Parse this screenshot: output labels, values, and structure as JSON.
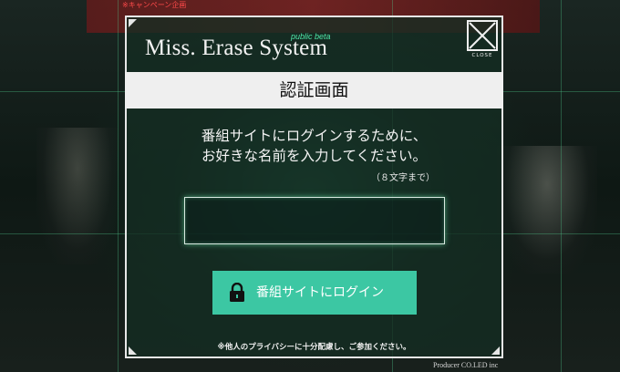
{
  "background": {
    "banner_note": "※キャンペーン企画"
  },
  "modal": {
    "logo": "Miss. Erase System",
    "beta_tag": "public beta",
    "close_label": "CLOSE",
    "title": "認証画面",
    "instruction_line1": "番組サイトにログインするために、",
    "instruction_line2": "お好きな名前を入力してください。",
    "limit_note": "（８文字まで）",
    "name_input": {
      "value": "",
      "placeholder": ""
    },
    "login_button": {
      "label": "番組サイトにログイン",
      "icon": "lock-icon",
      "color": "#3cc7a3"
    },
    "privacy_note": "※他人のプライバシーに十分配慮し、ご参加ください。"
  },
  "footer": {
    "producer": "Producer CO.LED inc"
  },
  "colors": {
    "accent_green": "#3cc7a3",
    "beta_green": "#4ee6a8",
    "frame": "#e6e6e6"
  }
}
